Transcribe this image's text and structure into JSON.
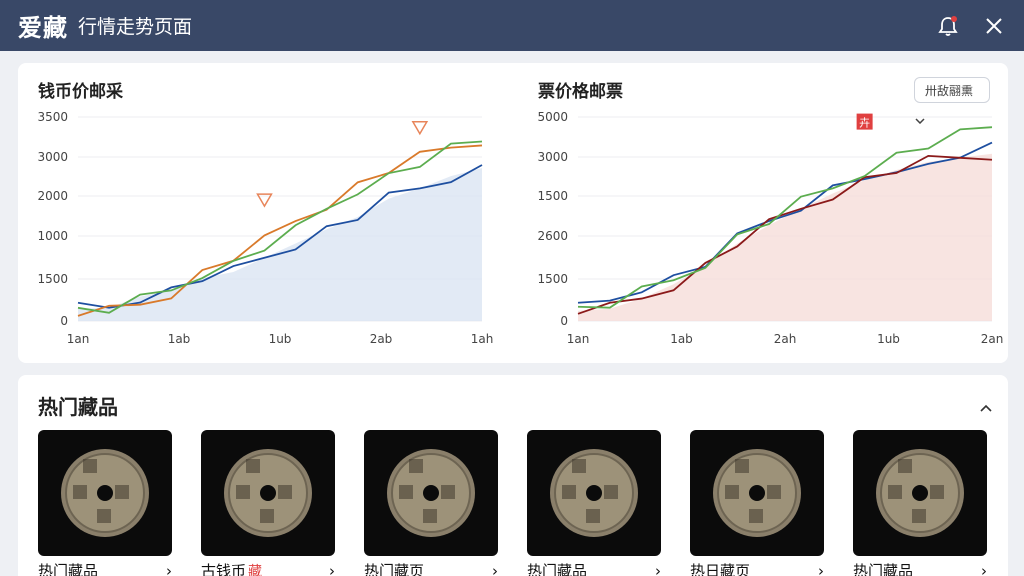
{
  "header": {
    "brand": "爱藏",
    "subtitle": "行情走势页面"
  },
  "chart_data": [
    {
      "type": "line",
      "title": "钱币价邮采",
      "yticks": [
        "3500",
        "3000",
        "2000",
        "1000",
        "1500",
        "0"
      ],
      "xticks": [
        "1an",
        "1ab",
        "1ub",
        "2ab",
        "1ah"
      ],
      "series": [
        {
          "color": "#1e4fa0",
          "values": [
            120,
            130,
            240,
            300,
            420,
            480,
            620,
            760,
            900,
            1020,
            1200,
            1300,
            1420,
            1500
          ]
        },
        {
          "color": "#d97a2b",
          "values": [
            80,
            90,
            160,
            280,
            470,
            620,
            780,
            980,
            1150,
            1330,
            1480,
            1600,
            1700,
            1780
          ]
        },
        {
          "color": "#5cad4f",
          "values": [
            100,
            110,
            200,
            300,
            480,
            560,
            720,
            880,
            1100,
            1300,
            1420,
            1540,
            1680,
            1760
          ]
        }
      ],
      "markers": [
        {
          "x_index": 6,
          "value": 930
        },
        {
          "x_index": 11,
          "value": 1640
        }
      ]
    },
    {
      "type": "line",
      "title": "票价格邮票",
      "yticks": [
        "5000",
        "3000",
        "1500",
        "2600",
        "1500",
        "0"
      ],
      "xticks": [
        "1an",
        "1ab",
        "2ah",
        "1ub",
        "2an"
      ],
      "filter_label": "卅敌翮熏",
      "series": [
        {
          "color": "#1e4fa0",
          "values": [
            120,
            200,
            340,
            420,
            560,
            800,
            980,
            1140,
            1300,
            1420,
            1400,
            1540,
            1660,
            1720
          ]
        },
        {
          "color": "#8b1a1a",
          "values": [
            100,
            120,
            220,
            360,
            540,
            760,
            940,
            1100,
            1250,
            1380,
            1480,
            1560,
            1600,
            1640
          ]
        },
        {
          "color": "#5cad4f",
          "values": [
            110,
            160,
            280,
            400,
            580,
            820,
            980,
            1160,
            1300,
            1480,
            1620,
            1720,
            1820,
            1900
          ]
        }
      ],
      "markers": [
        {
          "x_index": 9,
          "value": 1700,
          "label": "卉"
        }
      ]
    }
  ],
  "hot": {
    "title": "热门藏品",
    "items": [
      {
        "name": "热门藏品",
        "tag": ""
      },
      {
        "name": "古钱币",
        "tag": "藏"
      },
      {
        "name": "热门藏页",
        "tag": ""
      },
      {
        "name": "热门藏品",
        "tag": ""
      },
      {
        "name": "热日藏页",
        "tag": ""
      },
      {
        "name": "热门藏品",
        "tag": ""
      }
    ]
  },
  "colors": {
    "header": "#394867",
    "accent_red": "#e04040"
  },
  "icons": {
    "bell": "bell-icon",
    "close": "close-icon",
    "collapse": "chevron-up-icon",
    "item_arrow": "chevron-right-icon"
  }
}
